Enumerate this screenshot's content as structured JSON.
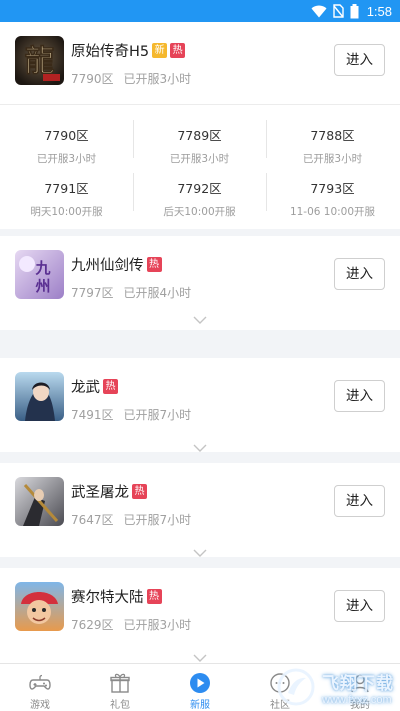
{
  "status_bar": {
    "time": "1:58"
  },
  "featured": {
    "name": "原始传奇H5",
    "tag_new": "新",
    "tag_hot": "热",
    "zone": "7790区",
    "opened": "已开服3小时",
    "button": "进入",
    "servers": [
      {
        "name": "7790区",
        "time": "已开服3小时"
      },
      {
        "name": "7789区",
        "time": "已开服3小时"
      },
      {
        "name": "7788区",
        "time": "已开服3小时"
      },
      {
        "name": "7791区",
        "time": "明天10:00开服"
      },
      {
        "name": "7792区",
        "time": "后天10:00开服"
      },
      {
        "name": "7793区",
        "time": "11-06 10:00开服"
      }
    ]
  },
  "games": [
    {
      "name": "九州仙剑传",
      "tag_hot": "热",
      "zone": "7797区",
      "opened": "已开服4小时",
      "button": "进入"
    },
    {
      "name": "龙武",
      "tag_hot": "热",
      "zone": "7491区",
      "opened": "已开服7小时",
      "button": "进入"
    },
    {
      "name": "武圣屠龙",
      "tag_hot": "热",
      "zone": "7647区",
      "opened": "已开服7小时",
      "button": "进入"
    },
    {
      "name": "赛尔特大陆",
      "tag_hot": "热",
      "zone": "7629区",
      "opened": "已开服3小时",
      "button": "进入"
    }
  ],
  "tabs": [
    {
      "label": "游戏",
      "icon": "gamepad-icon"
    },
    {
      "label": "礼包",
      "icon": "gift-icon"
    },
    {
      "label": "新服",
      "icon": "play-icon",
      "active": true
    },
    {
      "label": "社区",
      "icon": "community-icon"
    },
    {
      "label": "我的",
      "icon": "profile-icon"
    }
  ],
  "watermark": {
    "text": "飞翔下载",
    "url": "www.fxxz.com"
  },
  "colors": {
    "status_bar": "#2196f3",
    "tag_new": "#f5b82e",
    "tag_hot": "#e64458",
    "active_tab": "#2d8cf0"
  }
}
